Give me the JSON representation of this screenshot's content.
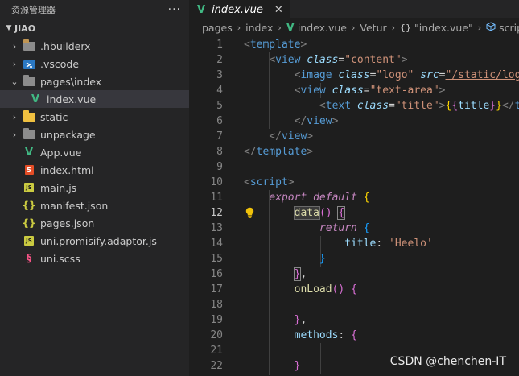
{
  "sidebar": {
    "title": "资源管理器",
    "more": "···",
    "section": "JIAO",
    "items": [
      {
        "label": ".hbuilderx",
        "kind": "folder",
        "chev": "›"
      },
      {
        "label": ".vscode",
        "kind": "vscode-folder",
        "chev": "›"
      },
      {
        "label": "pages\\index",
        "kind": "folder-open",
        "chev": "⌄"
      },
      {
        "label": "index.vue",
        "kind": "vue",
        "active": true
      },
      {
        "label": "static",
        "kind": "static-folder",
        "chev": "›"
      },
      {
        "label": "unpackage",
        "kind": "folder",
        "chev": "›"
      },
      {
        "label": "App.vue",
        "kind": "vue"
      },
      {
        "label": "index.html",
        "kind": "html"
      },
      {
        "label": "main.js",
        "kind": "js"
      },
      {
        "label": "manifest.json",
        "kind": "json"
      },
      {
        "label": "pages.json",
        "kind": "json"
      },
      {
        "label": "uni.promisify.adaptor.js",
        "kind": "js"
      },
      {
        "label": "uni.scss",
        "kind": "scss"
      }
    ]
  },
  "editor": {
    "tab": {
      "label": "index.vue",
      "close": "✕"
    },
    "breadcrumb": [
      "pages",
      "index",
      "index.vue",
      "Vetur",
      "\"index.vue\"",
      "script"
    ],
    "current_line": 12
  },
  "icons": {
    "vue": "V",
    "html": "5",
    "js": "JS",
    "json": "{}",
    "scss": "§",
    "vscode": "⟩",
    "bulb": "💡",
    "braces": "{}",
    "cube": "⬡"
  },
  "watermark": "CSDN @chenchen-IT"
}
